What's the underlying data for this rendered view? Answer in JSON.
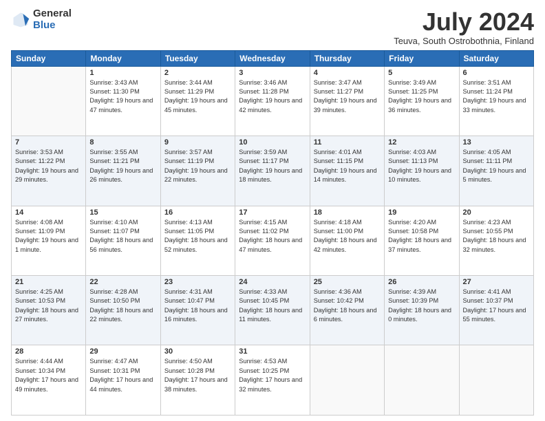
{
  "logo": {
    "general": "General",
    "blue": "Blue"
  },
  "title": "July 2024",
  "subtitle": "Teuva, South Ostrobothnia, Finland",
  "headers": [
    "Sunday",
    "Monday",
    "Tuesday",
    "Wednesday",
    "Thursday",
    "Friday",
    "Saturday"
  ],
  "weeks": [
    [
      {
        "day": "",
        "info": ""
      },
      {
        "day": "1",
        "info": "Sunrise: 3:43 AM\nSunset: 11:30 PM\nDaylight: 19 hours and 47 minutes."
      },
      {
        "day": "2",
        "info": "Sunrise: 3:44 AM\nSunset: 11:29 PM\nDaylight: 19 hours and 45 minutes."
      },
      {
        "day": "3",
        "info": "Sunrise: 3:46 AM\nSunset: 11:28 PM\nDaylight: 19 hours and 42 minutes."
      },
      {
        "day": "4",
        "info": "Sunrise: 3:47 AM\nSunset: 11:27 PM\nDaylight: 19 hours and 39 minutes."
      },
      {
        "day": "5",
        "info": "Sunrise: 3:49 AM\nSunset: 11:25 PM\nDaylight: 19 hours and 36 minutes."
      },
      {
        "day": "6",
        "info": "Sunrise: 3:51 AM\nSunset: 11:24 PM\nDaylight: 19 hours and 33 minutes."
      }
    ],
    [
      {
        "day": "7",
        "info": "Sunrise: 3:53 AM\nSunset: 11:22 PM\nDaylight: 19 hours and 29 minutes."
      },
      {
        "day": "8",
        "info": "Sunrise: 3:55 AM\nSunset: 11:21 PM\nDaylight: 19 hours and 26 minutes."
      },
      {
        "day": "9",
        "info": "Sunrise: 3:57 AM\nSunset: 11:19 PM\nDaylight: 19 hours and 22 minutes."
      },
      {
        "day": "10",
        "info": "Sunrise: 3:59 AM\nSunset: 11:17 PM\nDaylight: 19 hours and 18 minutes."
      },
      {
        "day": "11",
        "info": "Sunrise: 4:01 AM\nSunset: 11:15 PM\nDaylight: 19 hours and 14 minutes."
      },
      {
        "day": "12",
        "info": "Sunrise: 4:03 AM\nSunset: 11:13 PM\nDaylight: 19 hours and 10 minutes."
      },
      {
        "day": "13",
        "info": "Sunrise: 4:05 AM\nSunset: 11:11 PM\nDaylight: 19 hours and 5 minutes."
      }
    ],
    [
      {
        "day": "14",
        "info": "Sunrise: 4:08 AM\nSunset: 11:09 PM\nDaylight: 19 hours and 1 minute."
      },
      {
        "day": "15",
        "info": "Sunrise: 4:10 AM\nSunset: 11:07 PM\nDaylight: 18 hours and 56 minutes."
      },
      {
        "day": "16",
        "info": "Sunrise: 4:13 AM\nSunset: 11:05 PM\nDaylight: 18 hours and 52 minutes."
      },
      {
        "day": "17",
        "info": "Sunrise: 4:15 AM\nSunset: 11:02 PM\nDaylight: 18 hours and 47 minutes."
      },
      {
        "day": "18",
        "info": "Sunrise: 4:18 AM\nSunset: 11:00 PM\nDaylight: 18 hours and 42 minutes."
      },
      {
        "day": "19",
        "info": "Sunrise: 4:20 AM\nSunset: 10:58 PM\nDaylight: 18 hours and 37 minutes."
      },
      {
        "day": "20",
        "info": "Sunrise: 4:23 AM\nSunset: 10:55 PM\nDaylight: 18 hours and 32 minutes."
      }
    ],
    [
      {
        "day": "21",
        "info": "Sunrise: 4:25 AM\nSunset: 10:53 PM\nDaylight: 18 hours and 27 minutes."
      },
      {
        "day": "22",
        "info": "Sunrise: 4:28 AM\nSunset: 10:50 PM\nDaylight: 18 hours and 22 minutes."
      },
      {
        "day": "23",
        "info": "Sunrise: 4:31 AM\nSunset: 10:47 PM\nDaylight: 18 hours and 16 minutes."
      },
      {
        "day": "24",
        "info": "Sunrise: 4:33 AM\nSunset: 10:45 PM\nDaylight: 18 hours and 11 minutes."
      },
      {
        "day": "25",
        "info": "Sunrise: 4:36 AM\nSunset: 10:42 PM\nDaylight: 18 hours and 6 minutes."
      },
      {
        "day": "26",
        "info": "Sunrise: 4:39 AM\nSunset: 10:39 PM\nDaylight: 18 hours and 0 minutes."
      },
      {
        "day": "27",
        "info": "Sunrise: 4:41 AM\nSunset: 10:37 PM\nDaylight: 17 hours and 55 minutes."
      }
    ],
    [
      {
        "day": "28",
        "info": "Sunrise: 4:44 AM\nSunset: 10:34 PM\nDaylight: 17 hours and 49 minutes."
      },
      {
        "day": "29",
        "info": "Sunrise: 4:47 AM\nSunset: 10:31 PM\nDaylight: 17 hours and 44 minutes."
      },
      {
        "day": "30",
        "info": "Sunrise: 4:50 AM\nSunset: 10:28 PM\nDaylight: 17 hours and 38 minutes."
      },
      {
        "day": "31",
        "info": "Sunrise: 4:53 AM\nSunset: 10:25 PM\nDaylight: 17 hours and 32 minutes."
      },
      {
        "day": "",
        "info": ""
      },
      {
        "day": "",
        "info": ""
      },
      {
        "day": "",
        "info": ""
      }
    ]
  ]
}
